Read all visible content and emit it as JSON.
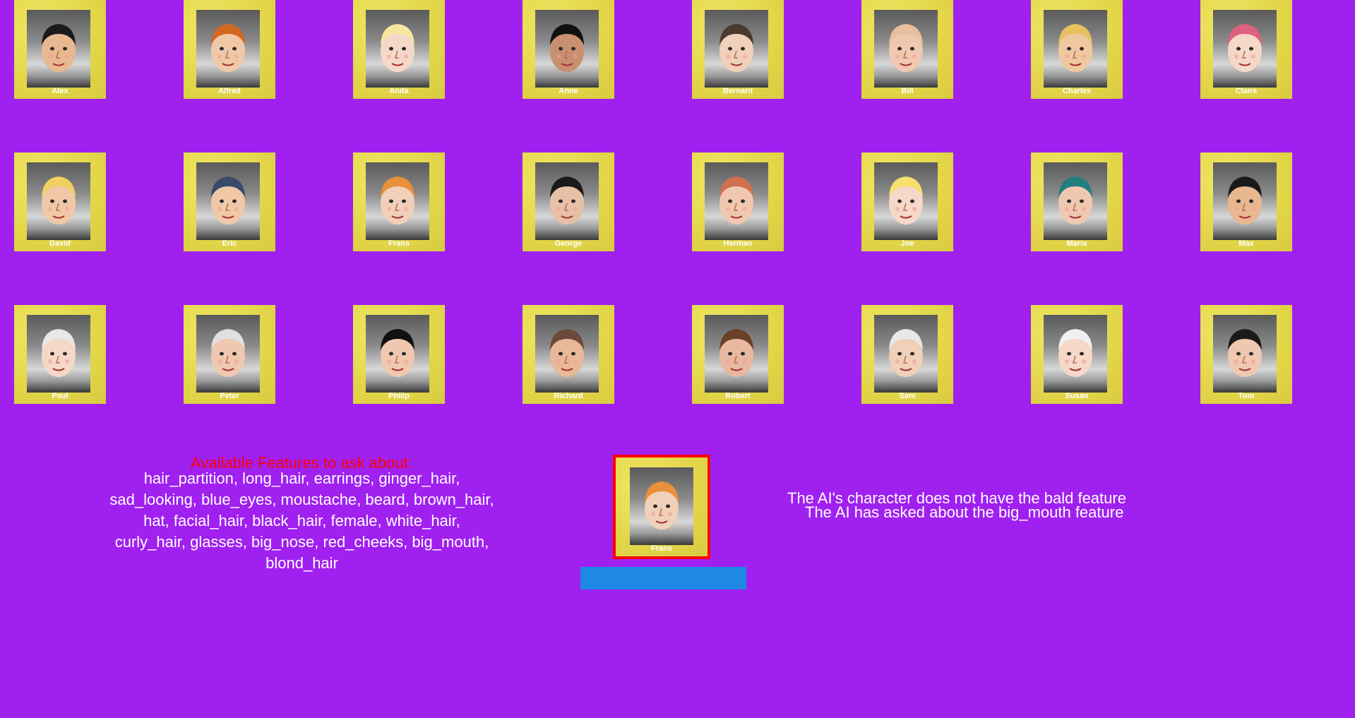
{
  "board": {
    "characters": [
      {
        "name": "Alex",
        "hair": "#1a1a1a",
        "skin": "#e8b890"
      },
      {
        "name": "Alfred",
        "hair": "#d2691e",
        "skin": "#f0c8a8"
      },
      {
        "name": "Anita",
        "hair": "#f5e6a0",
        "skin": "#f5d8c8"
      },
      {
        "name": "Anne",
        "hair": "#111111",
        "skin": "#c89070"
      },
      {
        "name": "Bernard",
        "hair": "#4a3a30",
        "skin": "#f0d0b8"
      },
      {
        "name": "Bill",
        "hair": "#e8c0a0",
        "skin": "#f0c8b0"
      },
      {
        "name": "Charles",
        "hair": "#e8c060",
        "skin": "#f0c8a0"
      },
      {
        "name": "Claire",
        "hair": "#e06080",
        "skin": "#f5d8c8"
      },
      {
        "name": "David",
        "hair": "#f0d060",
        "skin": "#f0c8a8"
      },
      {
        "name": "Eric",
        "hair": "#3a4a6a",
        "skin": "#f0c8a8"
      },
      {
        "name": "Frans",
        "hair": "#e8903a",
        "skin": "#f0d0b8"
      },
      {
        "name": "George",
        "hair": "#1a1a1a",
        "skin": "#e8c0a8"
      },
      {
        "name": "Herman",
        "hair": "#d07050",
        "skin": "#f0c8b0"
      },
      {
        "name": "Joe",
        "hair": "#f5e070",
        "skin": "#f5d8c8"
      },
      {
        "name": "Maria",
        "hair": "#208080",
        "skin": "#f0c8b0"
      },
      {
        "name": "Max",
        "hair": "#1a1a1a",
        "skin": "#e8b890"
      },
      {
        "name": "Paul",
        "hair": "#e8e8e8",
        "skin": "#f5d8c8"
      },
      {
        "name": "Peter",
        "hair": "#e0e0e0",
        "skin": "#f0c8b0"
      },
      {
        "name": "Philip",
        "hair": "#111111",
        "skin": "#f0c8b0"
      },
      {
        "name": "Richard",
        "hair": "#6a4a3a",
        "skin": "#e8b898"
      },
      {
        "name": "Robert",
        "hair": "#6a4028",
        "skin": "#e8b8a0"
      },
      {
        "name": "Sam",
        "hair": "#e8e8e8",
        "skin": "#f0d0b8"
      },
      {
        "name": "Susan",
        "hair": "#f0f0f0",
        "skin": "#f5d8c8"
      },
      {
        "name": "Tom",
        "hair": "#1a1a1a",
        "skin": "#f0c8b0"
      }
    ]
  },
  "features": {
    "title": "Available Features to ask about:",
    "list": "hair_partition, long_hair, earrings, ginger_hair, sad_looking, blue_eyes, moustache, beard, brown_hair, hat, facial_hair, black_hair, female, white_hair, curly_hair, glasses, big_nose, red_cheeks, big_mouth, blond_hair"
  },
  "selected": {
    "name": "Frans",
    "hair": "#e8903a",
    "skin": "#f0d0b8"
  },
  "ai": {
    "message_1": "The AI's character does not have the bald feature",
    "message_2": "The AI has asked about the big_mouth feature"
  },
  "colors": {
    "background": "#A020F0",
    "card": "#E5DA4E",
    "highlight": "#FF0000",
    "button": "#1E88E5"
  }
}
